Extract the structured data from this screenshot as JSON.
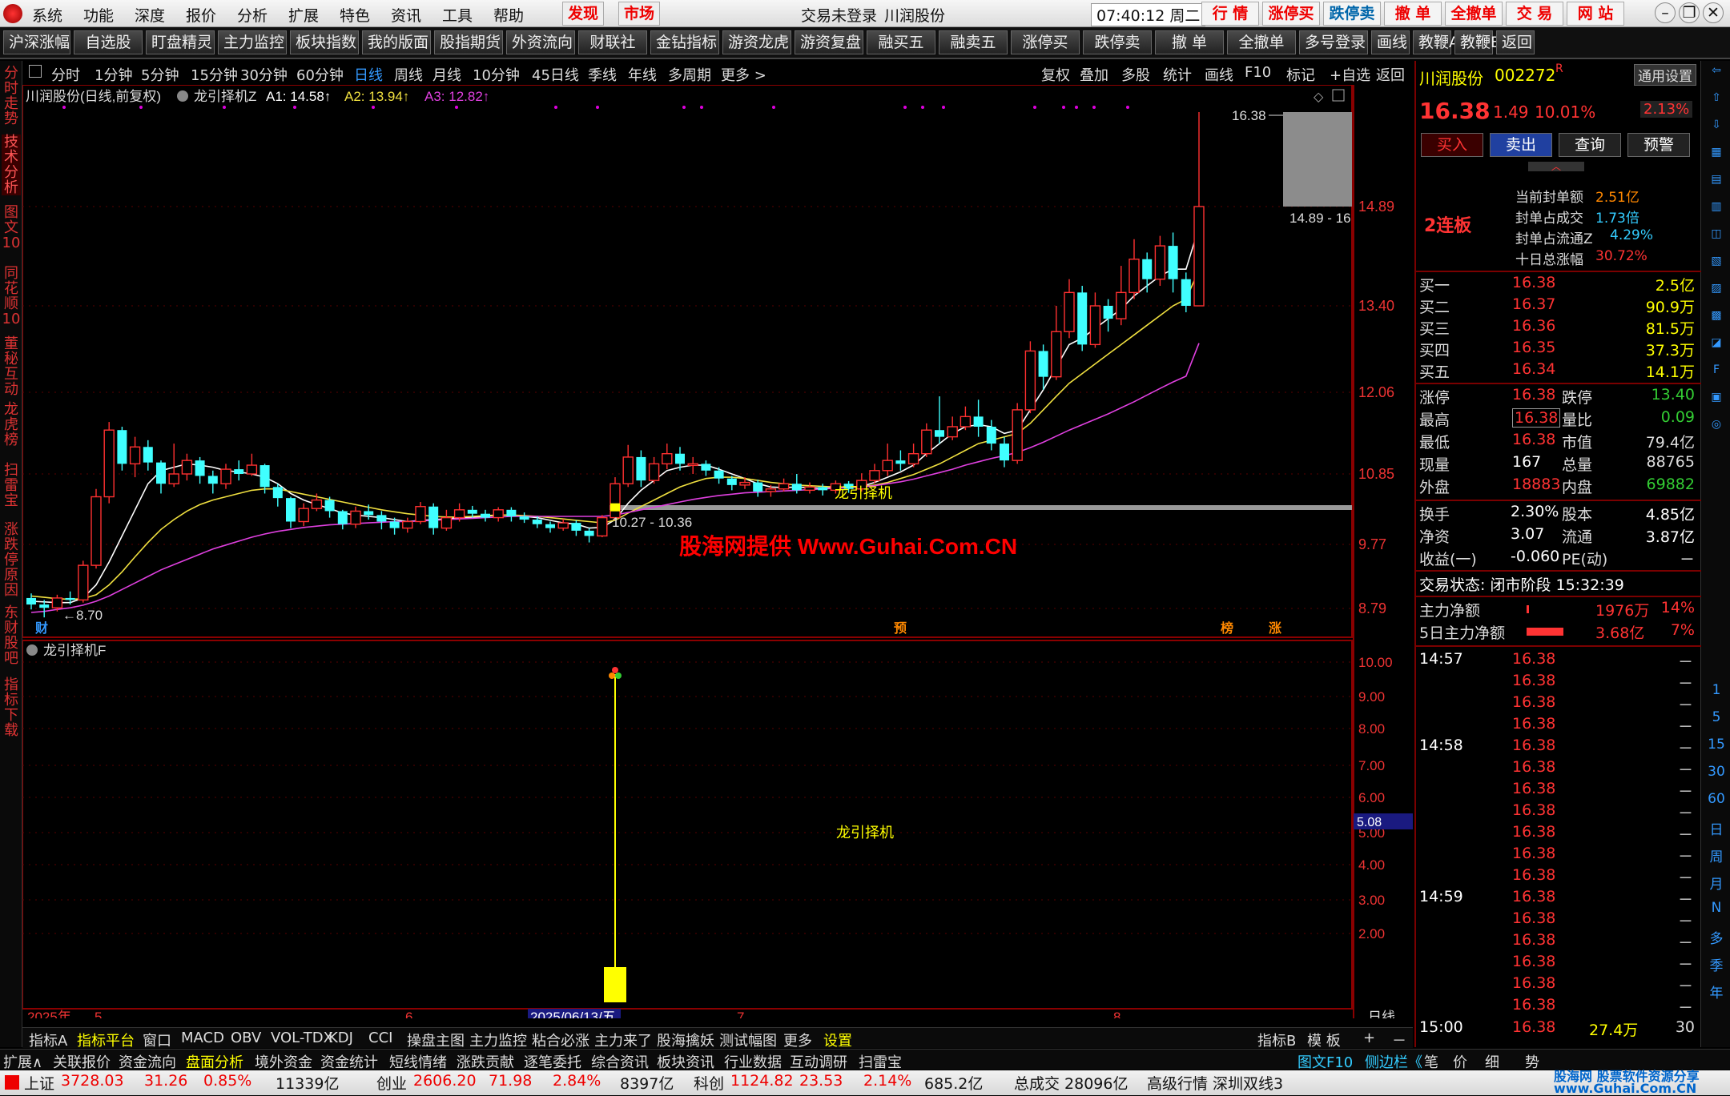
{
  "menubar": {
    "items": [
      "系统",
      "功能",
      "深度",
      "报价",
      "分析",
      "扩展",
      "特色",
      "资讯",
      "工具",
      "帮助"
    ],
    "highlight": [
      "发现",
      "市场"
    ],
    "login_status": "交易未登录",
    "stock_name": "川润股份",
    "time": "07:40:12 周二",
    "right_buttons": [
      "行 情",
      "涨停买",
      "跌停卖",
      "撤 单",
      "全撤单",
      "交 易",
      "网 站"
    ]
  },
  "toolbar": [
    "沪深涨幅",
    "自选股",
    "盯盘精灵",
    "主力监控",
    "板块指数",
    "我的版面",
    "股指期货",
    "外资流向",
    "财联社",
    "金钻指标",
    "游资龙虎",
    "游资复盘",
    "融买五",
    "融卖五",
    "涨停买",
    "跌停卖",
    "撤 单",
    "全撤单",
    "多号登录",
    "画线",
    "教鞭A",
    "教鞭B",
    "返回"
  ],
  "left_tabs": [
    "分时走势",
    "技术分析",
    "图文10",
    "同花顺10",
    "董秘互动",
    "龙虎榜",
    "扫雷宝",
    "涨跌停原因",
    "东财股吧",
    "指标下载"
  ],
  "period": {
    "items": [
      "分时",
      "1分钟",
      "5分钟",
      "15分钟",
      "30分钟",
      "60分钟",
      "日线",
      "周线",
      "月线",
      "10分钟",
      "45日线",
      "季线",
      "年线",
      "多周期",
      "更多 >"
    ],
    "active": "日线",
    "right": [
      "复权",
      "叠加",
      "多股",
      "统计",
      "画线",
      "F10",
      "标记",
      "+自选",
      "返回"
    ]
  },
  "main_chart": {
    "title": "川润股份(日线,前复权)",
    "indicator": "龙引择机Z",
    "ma_labels": [
      {
        "label": "A1: 14.58↑",
        "color": "#ffffff"
      },
      {
        "label": "A2: 13.94↑",
        "color": "#f0e040"
      },
      {
        "label": "A3: 12.82↑",
        "color": "#e040e0"
      }
    ],
    "price_ticks": [
      "14.89",
      "13.40",
      "12.06",
      "10.85",
      "9.77",
      "8.79"
    ],
    "high_label": "16.38",
    "high_range_label": "14.89 - 16",
    "low_label": "←8.70",
    "range_label": "10.27 - 10.36",
    "signal_text": "龙引择机",
    "watermark": "股海网提供 Www.Guhai.Com.CN",
    "markers": [
      "财",
      "预",
      "榜",
      "涨"
    ]
  },
  "sub_chart": {
    "indicator": "龙引择机F",
    "ticks": [
      "10.00",
      "9.00",
      "8.00",
      "7.00",
      "6.00",
      "5.00",
      "4.00",
      "3.00",
      "2.00"
    ],
    "current_value": "5.08",
    "signal_text": "龙引择机"
  },
  "date_axis": {
    "year": "2025年",
    "labels": [
      "5",
      "6",
      "2025/06/13/五",
      "7",
      "8"
    ],
    "period_label": "日线"
  },
  "chart_data": {
    "type": "candlestick",
    "ylim": [
      8.5,
      16.9
    ],
    "candles": [
      [
        8.95,
        8.85,
        9.02,
        8.78
      ],
      [
        8.85,
        8.8,
        8.92,
        8.7
      ],
      [
        8.8,
        8.95,
        9.0,
        8.76
      ],
      [
        8.95,
        8.92,
        9.05,
        8.85
      ],
      [
        8.92,
        9.45,
        9.52,
        8.88
      ],
      [
        9.45,
        10.5,
        10.62,
        9.4
      ],
      [
        10.5,
        11.5,
        11.62,
        10.4
      ],
      [
        11.5,
        11.0,
        11.55,
        10.9
      ],
      [
        11.0,
        11.25,
        11.4,
        10.8
      ],
      [
        11.25,
        11.02,
        11.35,
        10.9
      ],
      [
        11.02,
        10.7,
        11.05,
        10.55
      ],
      [
        10.7,
        10.85,
        11.3,
        10.65
      ],
      [
        10.85,
        11.05,
        11.15,
        10.75
      ],
      [
        11.05,
        10.82,
        11.1,
        10.7
      ],
      [
        10.82,
        10.7,
        10.9,
        10.55
      ],
      [
        10.7,
        10.92,
        11.0,
        10.62
      ],
      [
        10.92,
        10.85,
        11.05,
        10.75
      ],
      [
        10.85,
        10.98,
        11.15,
        10.82
      ],
      [
        10.98,
        10.65,
        11.0,
        10.55
      ],
      [
        10.65,
        10.48,
        10.7,
        10.35
      ],
      [
        10.48,
        10.12,
        10.5,
        10.02
      ],
      [
        10.12,
        10.32,
        10.4,
        10.05
      ],
      [
        10.32,
        10.45,
        10.55,
        10.28
      ],
      [
        10.45,
        10.28,
        10.5,
        10.18
      ],
      [
        10.28,
        10.08,
        10.3,
        10.0
      ],
      [
        10.08,
        10.28,
        10.35,
        10.02
      ],
      [
        10.28,
        10.22,
        10.38,
        10.15
      ],
      [
        10.22,
        10.12,
        10.28,
        10.0
      ],
      [
        10.12,
        10.02,
        10.18,
        9.92
      ],
      [
        10.02,
        10.12,
        10.18,
        9.95
      ],
      [
        10.12,
        10.35,
        10.42,
        10.08
      ],
      [
        10.35,
        10.02,
        10.4,
        9.92
      ],
      [
        10.02,
        10.18,
        10.3,
        9.98
      ],
      [
        10.18,
        10.3,
        10.4,
        10.12
      ],
      [
        10.3,
        10.24,
        10.36,
        10.18
      ],
      [
        10.24,
        10.18,
        10.3,
        10.12
      ],
      [
        10.18,
        10.3,
        10.34,
        10.12
      ],
      [
        10.3,
        10.2,
        10.34,
        10.12
      ],
      [
        10.2,
        10.15,
        10.26,
        10.1
      ],
      [
        10.15,
        10.08,
        10.2,
        10.02
      ],
      [
        10.08,
        10.02,
        10.12,
        9.95
      ],
      [
        10.02,
        10.1,
        10.16,
        9.98
      ],
      [
        10.1,
        9.98,
        10.14,
        9.9
      ],
      [
        9.98,
        9.9,
        10.02,
        9.8
      ],
      [
        9.9,
        10.18,
        10.22,
        9.88
      ],
      [
        10.18,
        10.7,
        10.8,
        10.15
      ],
      [
        10.7,
        11.1,
        11.28,
        10.65
      ],
      [
        11.1,
        10.75,
        11.2,
        10.65
      ],
      [
        10.75,
        11.0,
        11.1,
        10.7
      ],
      [
        11.0,
        11.15,
        11.3,
        10.92
      ],
      [
        11.15,
        11.0,
        11.25,
        10.9
      ],
      [
        11.0,
        11.0,
        11.1,
        10.85
      ],
      [
        11.0,
        10.9,
        11.05,
        10.82
      ],
      [
        10.9,
        10.78,
        10.95,
        10.7
      ],
      [
        10.78,
        10.68,
        10.82,
        10.6
      ],
      [
        10.68,
        10.72,
        10.8,
        10.62
      ],
      [
        10.72,
        10.58,
        10.76,
        10.5
      ],
      [
        10.58,
        10.62,
        10.68,
        10.5
      ],
      [
        10.62,
        10.7,
        10.78,
        10.58
      ],
      [
        10.7,
        10.6,
        10.85,
        10.55
      ],
      [
        10.6,
        10.65,
        10.72,
        10.55
      ],
      [
        10.65,
        10.6,
        10.7,
        10.52
      ],
      [
        10.6,
        10.7,
        10.75,
        10.55
      ],
      [
        10.7,
        10.62,
        10.74,
        10.56
      ],
      [
        10.62,
        10.75,
        10.86,
        10.58
      ],
      [
        10.75,
        10.9,
        11.0,
        10.7
      ],
      [
        10.9,
        11.05,
        11.3,
        10.82
      ],
      [
        11.05,
        11.0,
        11.2,
        10.9
      ],
      [
        11.0,
        11.15,
        11.3,
        10.95
      ],
      [
        11.15,
        11.5,
        11.6,
        11.1
      ],
      [
        11.5,
        11.4,
        12.0,
        11.3
      ],
      [
        11.4,
        11.55,
        11.7,
        11.35
      ],
      [
        11.55,
        11.7,
        11.85,
        11.5
      ],
      [
        11.7,
        11.55,
        11.95,
        11.4
      ],
      [
        11.55,
        11.3,
        11.65,
        11.2
      ],
      [
        11.3,
        11.05,
        11.4,
        10.95
      ],
      [
        11.05,
        11.8,
        11.9,
        11.0
      ],
      [
        11.8,
        12.7,
        12.85,
        11.75
      ],
      [
        12.7,
        12.3,
        12.8,
        12.1
      ],
      [
        12.3,
        13.0,
        13.4,
        12.25
      ],
      [
        13.0,
        13.6,
        13.8,
        12.9
      ],
      [
        13.6,
        12.8,
        13.7,
        12.7
      ],
      [
        12.8,
        13.4,
        13.6,
        12.75
      ],
      [
        13.4,
        13.2,
        13.5,
        13.0
      ],
      [
        13.2,
        13.6,
        14.0,
        13.1
      ],
      [
        13.6,
        14.1,
        14.4,
        13.5
      ],
      [
        14.1,
        13.8,
        14.2,
        13.6
      ],
      [
        13.8,
        14.3,
        14.45,
        13.7
      ],
      [
        14.3,
        13.8,
        14.5,
        13.6
      ],
      [
        13.8,
        13.4,
        13.9,
        13.3
      ],
      [
        13.4,
        14.89,
        16.38,
        13.4
      ]
    ],
    "ma": {
      "A1": [
        8.9,
        8.89,
        8.88,
        8.88,
        8.95,
        9.15,
        9.5,
        9.9,
        10.3,
        10.7,
        10.9,
        10.95,
        11.0,
        10.98,
        10.95,
        10.9,
        10.88,
        10.85,
        10.8,
        10.7,
        10.55,
        10.45,
        10.38,
        10.32,
        10.25,
        10.22,
        10.2,
        10.18,
        10.15,
        10.12,
        10.14,
        10.15,
        10.16,
        10.18,
        10.18,
        10.2,
        10.22,
        10.22,
        10.2,
        10.18,
        10.14,
        10.1,
        10.08,
        10.02,
        10.03,
        10.15,
        10.4,
        10.6,
        10.75,
        10.9,
        10.95,
        10.98,
        10.98,
        10.92,
        10.85,
        10.78,
        10.7,
        10.65,
        10.64,
        10.65,
        10.64,
        10.63,
        10.64,
        10.65,
        10.66,
        10.72,
        10.8,
        10.88,
        10.98,
        11.15,
        11.3,
        11.45,
        11.55,
        11.58,
        11.55,
        11.45,
        11.5,
        11.8,
        12.1,
        12.45,
        12.8,
        12.9,
        13.05,
        13.2,
        13.35,
        13.55,
        13.7,
        13.85,
        13.95,
        13.95,
        14.58
      ],
      "A2": [
        8.98,
        8.96,
        8.94,
        8.93,
        8.94,
        9.0,
        9.15,
        9.35,
        9.58,
        9.8,
        10.0,
        10.15,
        10.28,
        10.38,
        10.45,
        10.5,
        10.55,
        10.6,
        10.62,
        10.62,
        10.58,
        10.54,
        10.5,
        10.46,
        10.42,
        10.38,
        10.34,
        10.3,
        10.27,
        10.24,
        10.22,
        10.2,
        10.19,
        10.19,
        10.2,
        10.21,
        10.22,
        10.22,
        10.21,
        10.2,
        10.18,
        10.16,
        10.14,
        10.12,
        10.1,
        10.14,
        10.25,
        10.35,
        10.45,
        10.55,
        10.65,
        10.72,
        10.78,
        10.8,
        10.8,
        10.78,
        10.75,
        10.72,
        10.7,
        10.68,
        10.67,
        10.66,
        10.65,
        10.65,
        10.66,
        10.68,
        10.72,
        10.78,
        10.84,
        10.92,
        11.0,
        11.1,
        11.2,
        11.3,
        11.35,
        11.4,
        11.45,
        11.6,
        11.8,
        12.0,
        12.2,
        12.35,
        12.5,
        12.65,
        12.8,
        12.95,
        13.1,
        13.25,
        13.4,
        13.5,
        13.94
      ],
      "A3": [
        8.75,
        8.76,
        8.78,
        8.8,
        8.84,
        8.9,
        8.98,
        9.08,
        9.18,
        9.28,
        9.38,
        9.46,
        9.54,
        9.62,
        9.7,
        9.76,
        9.82,
        9.88,
        9.93,
        9.97,
        10.0,
        10.03,
        10.05,
        10.07,
        10.08,
        10.09,
        10.1,
        10.11,
        10.12,
        10.12,
        10.13,
        10.14,
        10.15,
        10.16,
        10.17,
        10.18,
        10.19,
        10.2,
        10.2,
        10.2,
        10.2,
        10.2,
        10.2,
        10.2,
        10.2,
        10.22,
        10.26,
        10.3,
        10.34,
        10.38,
        10.42,
        10.46,
        10.49,
        10.52,
        10.54,
        10.56,
        10.57,
        10.58,
        10.59,
        10.6,
        10.61,
        10.62,
        10.63,
        10.64,
        10.65,
        10.67,
        10.7,
        10.73,
        10.77,
        10.82,
        10.87,
        10.92,
        10.98,
        11.03,
        11.08,
        11.12,
        11.17,
        11.24,
        11.32,
        11.41,
        11.5,
        11.58,
        11.66,
        11.74,
        11.83,
        11.92,
        12.02,
        12.12,
        12.22,
        12.31,
        12.82
      ]
    }
  },
  "quote": {
    "name": "川润股份",
    "code": "002272",
    "code_suffix": "R",
    "settings": "通用设置",
    "price": "16.38",
    "change": "1.49",
    "change_pct": "10.01%",
    "amp": "2.13%",
    "buttons": [
      "买入",
      "卖出",
      "查询",
      "预警"
    ],
    "board": "2连板",
    "seal": [
      {
        "label": "当前封单额",
        "value": "2.51亿"
      },
      {
        "label": "封单占成交",
        "value": "1.73倍"
      },
      {
        "label": "封单占流通Z",
        "value": "4.29%"
      },
      {
        "label": "十日总涨幅",
        "value": "30.72%"
      }
    ],
    "bids": [
      {
        "label": "买一",
        "price": "16.38",
        "vol": "2.5亿"
      },
      {
        "label": "买二",
        "price": "16.37",
        "vol": "90.9万"
      },
      {
        "label": "买三",
        "price": "16.36",
        "vol": "81.5万"
      },
      {
        "label": "买四",
        "price": "16.35",
        "vol": "37.3万"
      },
      {
        "label": "买五",
        "price": "16.34",
        "vol": "14.1万"
      }
    ],
    "stats1": [
      {
        "l1": "涨停",
        "v1": "16.38",
        "l2": "跌停",
        "v2": "13.40",
        "c2": "#3c3"
      },
      {
        "l1": "最高",
        "v1": "16.38",
        "l2": "量比",
        "v2": "0.09",
        "c2": "#3c3"
      },
      {
        "l1": "最低",
        "v1": "16.38",
        "l2": "市值",
        "v2": "79.4亿",
        "c2": "#ddd"
      },
      {
        "l1": "现量",
        "v1": "167",
        "l2": "总量",
        "v2": "88765",
        "c2": "#ddd"
      },
      {
        "l1": "外盘",
        "v1": "18883",
        "l2": "内盘",
        "v2": "69882",
        "c2": "#3c3"
      }
    ],
    "stats2": [
      {
        "l1": "换手",
        "v1": "2.30%",
        "l2": "股本",
        "v2": "4.85亿"
      },
      {
        "l1": "净资",
        "v1": "3.07",
        "l2": "流通",
        "v2": "3.87亿"
      },
      {
        "l1": "收益(一)",
        "v1": "-0.060",
        "l2": "PE(动)",
        "v2": "－"
      }
    ],
    "trade_status": "交易状态: 闭市阶段 15:32:39",
    "flow": [
      {
        "label": "主力净额",
        "value": "1976万",
        "pct": "14%",
        "bar": 0.02
      },
      {
        "label": "5日主力净额",
        "value": "3.68亿",
        "pct": "7%",
        "bar": 1.0
      }
    ],
    "ticks": [
      {
        "time": "14:57",
        "price": "16.38",
        "vol": "－"
      },
      {
        "time": "",
        "price": "16.38",
        "vol": "－"
      },
      {
        "time": "",
        "price": "16.38",
        "vol": "－"
      },
      {
        "time": "",
        "price": "16.38",
        "vol": "－"
      },
      {
        "time": "14:58",
        "price": "16.38",
        "vol": "－"
      },
      {
        "time": "",
        "price": "16.38",
        "vol": "－"
      },
      {
        "time": "",
        "price": "16.38",
        "vol": "－"
      },
      {
        "time": "",
        "price": "16.38",
        "vol": "－"
      },
      {
        "time": "",
        "price": "16.38",
        "vol": "－"
      },
      {
        "time": "",
        "price": "16.38",
        "vol": "－"
      },
      {
        "time": "",
        "price": "16.38",
        "vol": "－"
      },
      {
        "time": "14:59",
        "price": "16.38",
        "vol": "－"
      },
      {
        "time": "",
        "price": "16.38",
        "vol": "－"
      },
      {
        "time": "",
        "price": "16.38",
        "vol": "－"
      },
      {
        "time": "",
        "price": "16.38",
        "vol": "－"
      },
      {
        "time": "",
        "price": "16.38",
        "vol": "－"
      },
      {
        "time": "",
        "price": "16.38",
        "vol": "－"
      }
    ],
    "last_tick": {
      "time": "15:00",
      "price": "16.38",
      "vol": "27.4万",
      "n": "30"
    }
  },
  "right_icons": [
    "1",
    "5",
    "15",
    "30",
    "60",
    "日",
    "周",
    "月",
    "N",
    "多",
    "季",
    "年"
  ],
  "bottom_tabs": [
    "指标A",
    "指标平台",
    "窗口",
    "MACD",
    "OBV",
    "VOL-TDX",
    "KDJ",
    "CCI",
    "操盘主图",
    "主力监控",
    "粘合必涨",
    "主力来了",
    "股海擒妖",
    "测试幅图",
    "更多",
    "设置"
  ],
  "bottom_right": [
    "指标B",
    "模 板",
    "+",
    "－"
  ],
  "bottom_bar2": [
    "扩展∧",
    "关联报价",
    "资金流向",
    "盘面分析",
    "境外资金",
    "资金统计",
    "短线情绪",
    "涨跌贡献",
    "逐笔委托",
    "综合资讯",
    "板块资讯",
    "行业数据",
    "互动调研",
    "扫雷宝"
  ],
  "bottom_bar2_right": [
    "图文F10",
    "侧边栏《",
    "笔",
    "价",
    "细",
    "势"
  ],
  "status": {
    "items": [
      {
        "label": "上证",
        "value": "3728.03",
        "chg": "31.26",
        "pct": "0.85%",
        "amt": "11339亿"
      },
      {
        "label": "创业",
        "value": "2606.20",
        "chg": "71.98",
        "pct": "2.84%",
        "amt": "8397亿"
      },
      {
        "label": "科创",
        "value": "1124.82",
        "chg": "23.53",
        "pct": "2.14%",
        "amt": "685.2亿"
      }
    ],
    "total": "总成交 28096亿",
    "line": "高级行情 深圳双线3",
    "brand": "股海网 股票软件资源分享 www.Guhai.Com.CN"
  }
}
